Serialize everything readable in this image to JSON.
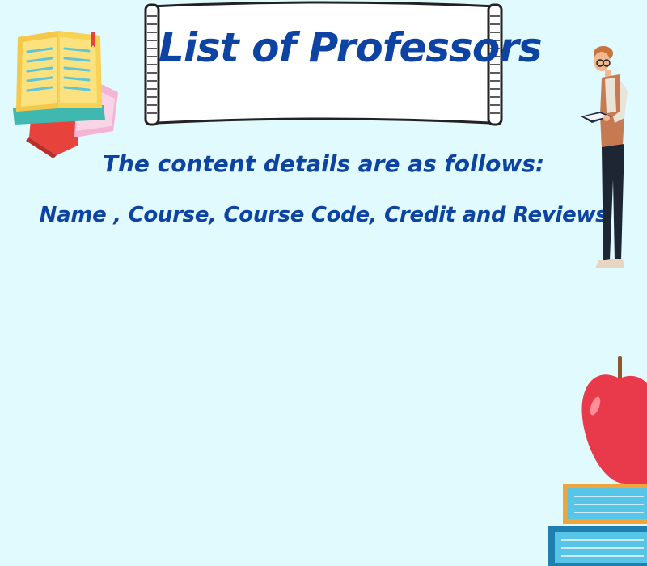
{
  "page": {
    "title": "List of Professors",
    "subtitle_line1": "The content details are as follows:",
    "subtitle_line2": "Name , Course, Course Code, Credit and Reviews"
  },
  "colors": {
    "background": "#e0fafd",
    "text": "#0d44a3"
  },
  "decorations": [
    "book-stack-icon",
    "banner-scroll",
    "professor-reading-illustration",
    "apple-on-books-icon"
  ]
}
